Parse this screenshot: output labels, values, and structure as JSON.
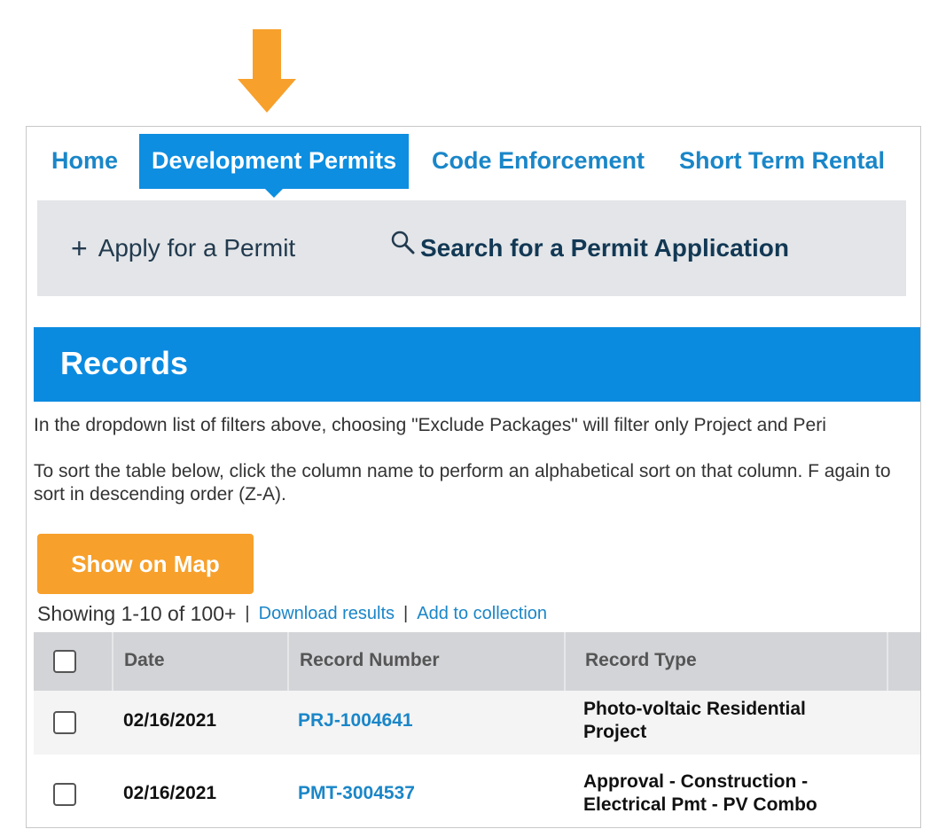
{
  "colors": {
    "nav_active_bg": "#0d8ee0",
    "nav_link": "#1a86c8",
    "records_header_bg": "#0b8be0",
    "map_button_bg": "#f7a02b",
    "callout_arrow": "#f7a02b"
  },
  "nav": {
    "tabs": [
      {
        "label": "Home",
        "active": false
      },
      {
        "label": "Development Permits",
        "active": true
      },
      {
        "label": "Code Enforcement",
        "active": false
      },
      {
        "label": "Short Term Rental",
        "active": false
      }
    ]
  },
  "submenu": {
    "apply": {
      "icon": "plus-icon",
      "label": "Apply for a Permit"
    },
    "search": {
      "icon": "search-icon",
      "label": "Search for a Permit Application"
    }
  },
  "records": {
    "title": "Records",
    "info1": "In the dropdown list of filters above, choosing \"Exclude Packages\" will filter only Project and Peri",
    "info2": "To sort the table below, click the column name to perform an alphabetical sort on that column. F again to sort in descending order (Z-A).",
    "map_button": "Show on Map",
    "showing": "Showing 1-10 of 100+",
    "download_link": "Download results",
    "collection_link": "Add to collection",
    "separator": "|"
  },
  "table": {
    "headers": [
      "Date",
      "Record Number",
      "Record Type"
    ],
    "rows": [
      {
        "date": "02/16/2021",
        "record_number": "PRJ-1004641",
        "record_type": "Photo-voltaic Residential Project"
      },
      {
        "date": "02/16/2021",
        "record_number": "PMT-3004537",
        "record_type": "Approval - Construction - Electrical Pmt - PV Combo"
      }
    ]
  }
}
